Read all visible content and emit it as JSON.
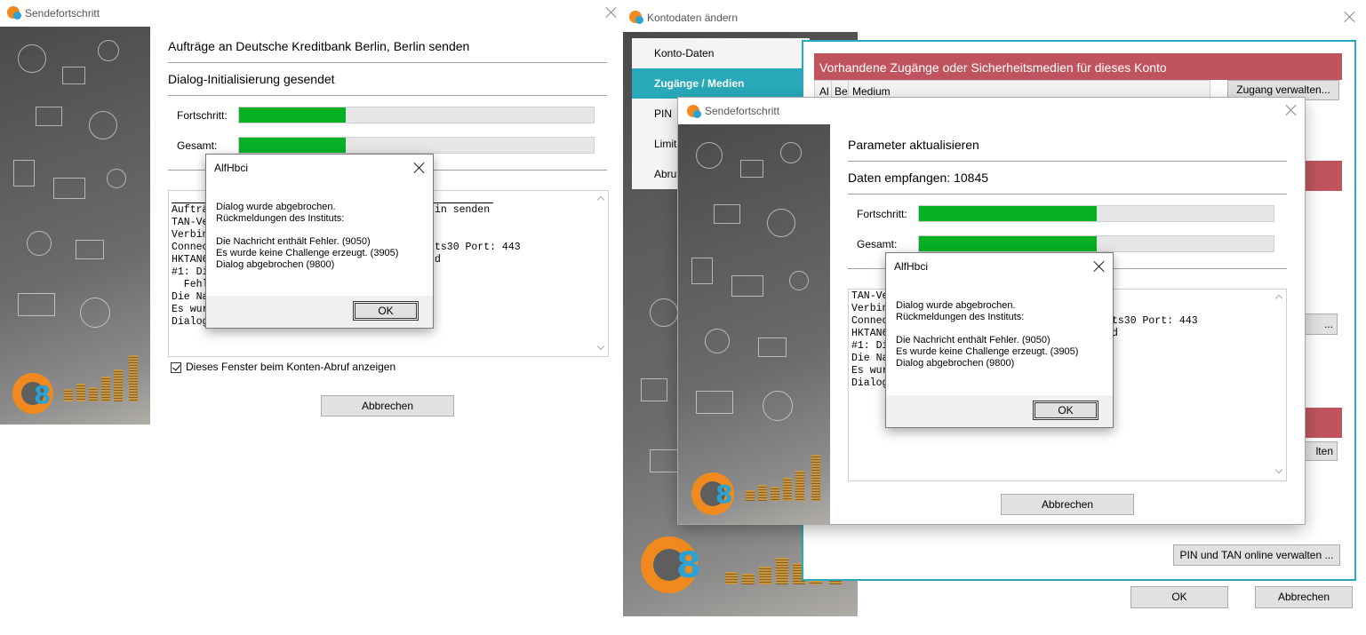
{
  "win1": {
    "title": "Sendefortschritt",
    "heading": "Aufträge an Deutsche Kreditbank Berlin, Berlin senden",
    "status": "Dialog-Initialisierung gesendet",
    "progress_label": "Fortschritt:",
    "progress_value": 0.3,
    "total_label": "Gesamt:",
    "total_value": 0.3,
    "log_lines": [
      "Aufträ",
      "TAN-Ve",
      "Verbin",
      "Connec",
      "HKTAN6",
      "#1: Di",
      "  Fehl",
      "Die Na",
      "Es wur",
      "Dialog"
    ],
    "log_line0_tail": "in senden",
    "log_line3_tail": "ts30 Port: 443",
    "log_line4_tail": "d",
    "checkbox_label": "Dieses Fenster beim Konten-Abruf anzeigen",
    "checkbox_checked": true,
    "cancel_label": "Abbrechen"
  },
  "msg1": {
    "title": "AlfHbci",
    "lines": [
      "Dialog wurde abgebrochen.",
      "Rückmeldungen des Instituts:",
      "",
      "Die Nachricht enthält Fehler. (9050)",
      "Es wurde keine Challenge erzeugt. (3905)",
      "Dialog abgebrochen (9800)"
    ],
    "ok_label": "OK"
  },
  "win2": {
    "title": "Kontodaten ändern",
    "tabs": [
      "Konto-Daten",
      "Zugänge / Medien",
      "PIN",
      "Limits",
      "Abruf"
    ],
    "active_tab": 1,
    "section_title": "Vorhandene Zugänge oder Sicherheitsmedien für dieses Konto",
    "col_al": "Al",
    "col_be": "Be",
    "col_medium": "Medium",
    "manage_access_label": "Zugang verwalten...",
    "hidden_btn1_label": "...",
    "hidden_btn2_label": "lten",
    "pin_tan_label": "PIN und TAN online verwalten ...",
    "ok_label": "OK",
    "cancel_label": "Abbrechen"
  },
  "win3": {
    "title": "Sendefortschritt",
    "heading": "Parameter aktualisieren",
    "status": "Daten empfangen: 10845",
    "progress_label": "Fortschritt:",
    "progress_value": 0.5,
    "total_label": "Gesamt:",
    "total_value": 0.5,
    "log_lines": [
      "TAN-Ve",
      "Verbin",
      "Connec",
      "HKTAN6",
      "#1: Di",
      "Die Na",
      "Es wur",
      "Dialog"
    ],
    "log_line2_tail": "ts30 Port: 443",
    "log_line3_tail": "d",
    "cancel_label": "Abbrechen"
  },
  "msg2": {
    "title": "AlfHbci",
    "lines": [
      "Dialog wurde abgebrochen.",
      "Rückmeldungen des Instituts:",
      "",
      "Die Nachricht enthält Fehler. (9050)",
      "Es wurde keine Challenge erzeugt. (3905)",
      "Dialog abgebrochen (9800)"
    ],
    "ok_label": "OK"
  },
  "colors": {
    "progress_green": "#06b025",
    "accent_teal": "#28a8b8",
    "section_red": "#c0545e",
    "logo_orange": "#f08a1e",
    "logo_blue": "#2aa3d4"
  },
  "icons": [
    "app-logo-icon",
    "close-icon",
    "checkbox-checked-icon"
  ]
}
